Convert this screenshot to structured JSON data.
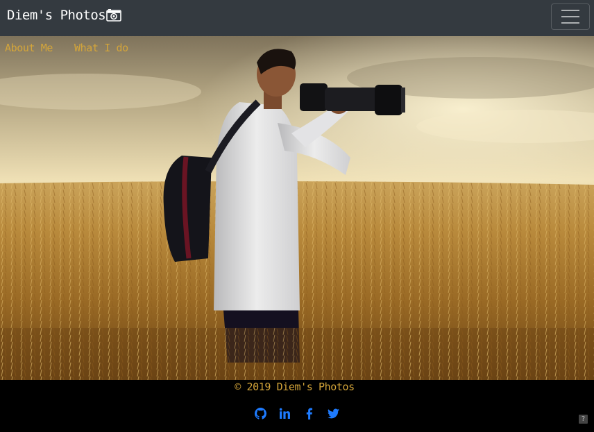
{
  "navbar": {
    "brand_text": "Diem's Photos",
    "brand_icon": "camera-icon",
    "toggler_icon": "hamburger-menu-icon"
  },
  "hero": {
    "links": [
      {
        "label": "About Me"
      },
      {
        "label": "What I do"
      }
    ],
    "image_alt": "photographer-in-wheat-field"
  },
  "footer": {
    "copyright": "© 2019 Diem's Photos",
    "social_icons": [
      "github-icon",
      "linkedin-icon",
      "facebook-icon",
      "twitter-icon"
    ],
    "help_label": "?"
  },
  "colors": {
    "navbar_bg": "#343a40",
    "link_gold": "#d4a53a",
    "social_blue": "#1e7bff",
    "footer_bg": "#000000"
  }
}
